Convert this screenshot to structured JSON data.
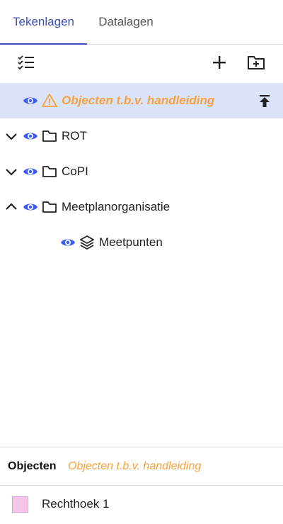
{
  "tabs": [
    {
      "label": "Tekenlagen",
      "active": true
    },
    {
      "label": "Datalagen",
      "active": false
    }
  ],
  "toolbar": {
    "select_icon": "checklist-icon",
    "add_icon": "plus-icon",
    "add_folder_icon": "folder-plus-icon"
  },
  "tree": {
    "rows": [
      {
        "label": "Objecten t.b.v. handleiding",
        "type": "layer-warning",
        "selected": true,
        "visible": true
      },
      {
        "label": "ROT",
        "type": "folder",
        "expanded": false,
        "visible": true
      },
      {
        "label": "CoPI",
        "type": "folder",
        "expanded": false,
        "visible": true
      },
      {
        "label": "Meetplanorganisatie",
        "type": "folder",
        "expanded": true,
        "visible": true
      },
      {
        "label": "Meetpunten",
        "type": "layer",
        "visible": true
      }
    ]
  },
  "objects": {
    "title": "Objecten",
    "layer_name": "Objecten t.b.v. handleiding",
    "items": [
      {
        "name": "Rechthoek 1",
        "color": "#f6c6ea"
      }
    ]
  },
  "colors": {
    "accent": "#3f51b5",
    "selected_bg": "#dbe3fb",
    "warning": "#f7a13a",
    "eye": "#3d5afe"
  }
}
